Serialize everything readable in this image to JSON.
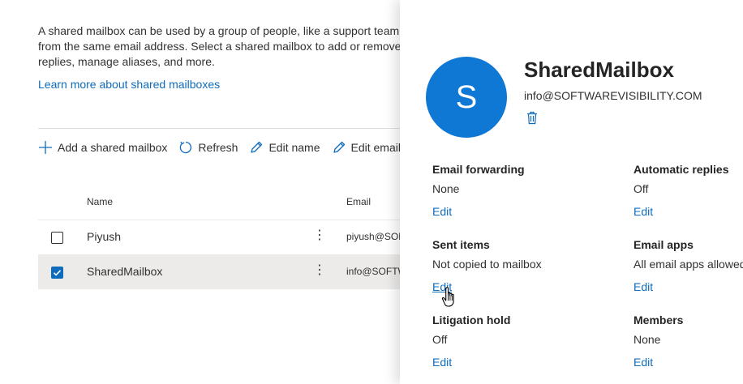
{
  "page": {
    "description_lines": [
      "A shared mailbox can be used by a group of people, like a support team,",
      "from the same email address. Select a shared mailbox to add or remove",
      "replies, manage aliases, and more."
    ],
    "learn_more_link": "Learn more about shared mailboxes"
  },
  "toolbar": {
    "add_label": "Add a shared mailbox",
    "refresh_label": "Refresh",
    "edit_name_label": "Edit name",
    "edit_email_label": "Edit email"
  },
  "table": {
    "columns": [
      "Name",
      "Email"
    ],
    "rows": [
      {
        "name": "Piyush",
        "email": "piyush@SOFTWAREVISIBILITY.COM",
        "selected": false
      },
      {
        "name": "SharedMailbox",
        "email": "info@SOFTWAREVISIBILITY.COM",
        "selected": true
      }
    ],
    "more_glyph": "⋮"
  },
  "panel": {
    "avatar_initial": "S",
    "title": "SharedMailbox",
    "email": "info@SOFTWAREVISIBILITY.COM",
    "sections": [
      {
        "label": "Email forwarding",
        "value": "None",
        "edit": "Edit"
      },
      {
        "label": "Automatic replies",
        "value": "Off",
        "edit": "Edit"
      },
      {
        "label": "Sent items",
        "value": "Not copied to mailbox",
        "edit": "Edit"
      },
      {
        "label": "Email apps",
        "value": "All email apps allowed",
        "edit": "Edit"
      },
      {
        "label": "Litigation hold",
        "value": "Off",
        "edit": "Edit"
      },
      {
        "label": "Members",
        "value": "None",
        "edit": "Edit"
      }
    ]
  },
  "icons": {
    "add": "plus-icon",
    "refresh": "refresh-icon",
    "edit": "pencil-icon",
    "delete": "trash-icon",
    "cursor": "hand-pointer-icon"
  },
  "colors": {
    "accent": "#0f6cbd",
    "avatar": "#0f78d4",
    "selected_row": "#edebe9"
  }
}
